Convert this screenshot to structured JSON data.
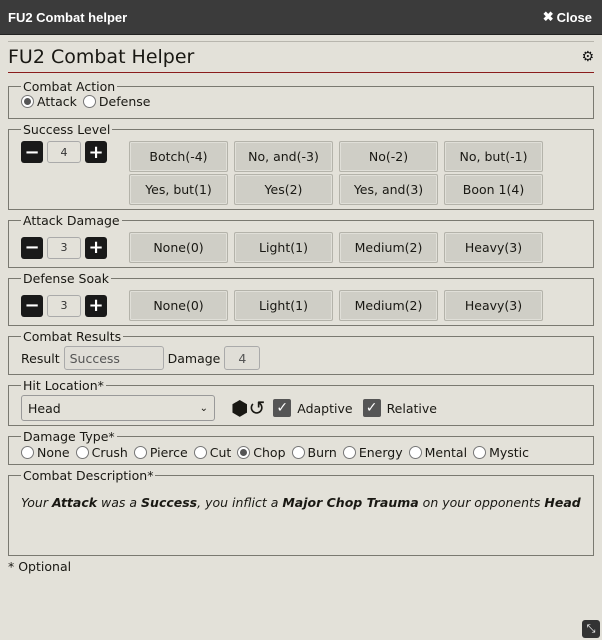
{
  "window": {
    "title": "FU2 Combat helper",
    "close_label": "Close",
    "close_icon": "x-icon"
  },
  "header": {
    "title": "FU2 Combat Helper",
    "settings_icon": "gear-icon"
  },
  "combat_action": {
    "legend": "Combat Action",
    "options": [
      {
        "label": "Attack",
        "checked": true
      },
      {
        "label": "Defense",
        "checked": false
      }
    ]
  },
  "success_level": {
    "legend": "Success Level",
    "value": "4",
    "buttons": [
      "Botch(-4)",
      "No, and(-3)",
      "No(-2)",
      "No, but(-1)",
      "Yes, but(1)",
      "Yes(2)",
      "Yes, and(3)",
      "Boon 1(4)"
    ]
  },
  "attack_damage": {
    "legend": "Attack Damage",
    "value": "3",
    "buttons": [
      "None(0)",
      "Light(1)",
      "Medium(2)",
      "Heavy(3)"
    ]
  },
  "defense_soak": {
    "legend": "Defense Soak",
    "value": "3",
    "buttons": [
      "None(0)",
      "Light(1)",
      "Medium(2)",
      "Heavy(3)"
    ]
  },
  "combat_results": {
    "legend": "Combat Results",
    "result_label": "Result",
    "result_value": "Success",
    "damage_label": "Damage",
    "damage_value": "4"
  },
  "hit_location": {
    "legend": "Hit Location*",
    "selected": "Head",
    "adaptive_label": "Adaptive",
    "adaptive_checked": true,
    "relative_label": "Relative",
    "relative_checked": true
  },
  "damage_type": {
    "legend": "Damage Type*",
    "options": [
      {
        "label": "None",
        "checked": false
      },
      {
        "label": "Crush",
        "checked": false
      },
      {
        "label": "Pierce",
        "checked": false
      },
      {
        "label": "Cut",
        "checked": false
      },
      {
        "label": "Chop",
        "checked": true
      },
      {
        "label": "Burn",
        "checked": false
      },
      {
        "label": "Energy",
        "checked": false
      },
      {
        "label": "Mental",
        "checked": false
      },
      {
        "label": "Mystic",
        "checked": false
      }
    ]
  },
  "combat_description": {
    "legend": "Combat Description*",
    "parts": [
      {
        "t": "Your ",
        "b": false
      },
      {
        "t": "Attack",
        "b": true
      },
      {
        "t": " was a ",
        "b": false
      },
      {
        "t": "Success",
        "b": true
      },
      {
        "t": ", you inflict a ",
        "b": false
      },
      {
        "t": "Major Chop Trauma",
        "b": true
      },
      {
        "t": " on your opponents ",
        "b": false
      },
      {
        "t": "Head",
        "b": true
      }
    ]
  },
  "footer": {
    "note": "* Optional"
  }
}
